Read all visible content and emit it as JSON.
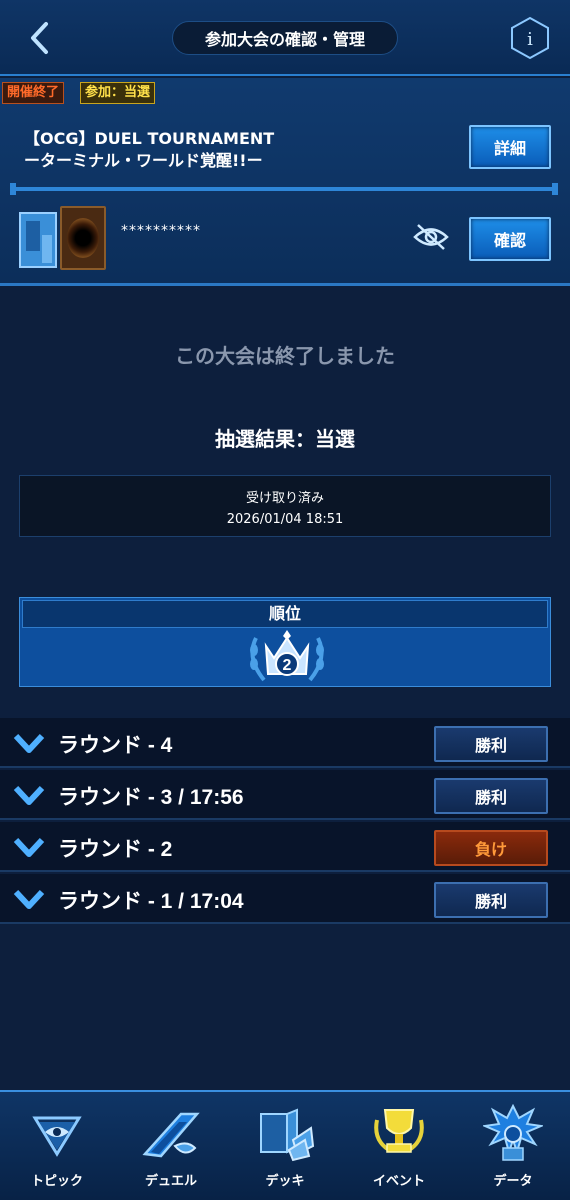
{
  "header": {
    "title": "参加大会の確認・管理",
    "info_label": "i"
  },
  "tournament": {
    "status_tag": "開催終了",
    "entry_tag": "参加：当選",
    "title_line1": "【OCG】DUEL TOURNAMENT",
    "title_line2": "ーターミナル・ワールド覚醒!!ー",
    "detail_button": "詳細",
    "deck_name_masked": "**********",
    "confirm_button": "確認"
  },
  "main": {
    "ended_message": "この大会は終了しました",
    "lottery_result": "抽選結果：当選",
    "receipt_status": "受け取り済み",
    "receipt_time": "2026/01/04 18:51",
    "rank_header": "順位",
    "rank_value": "2"
  },
  "rounds": [
    {
      "label": "ラウンド - 4",
      "result": "勝利",
      "outcome": "win"
    },
    {
      "label": "ラウンド - 3 / 17:56",
      "result": "勝利",
      "outcome": "win"
    },
    {
      "label": "ラウンド - 2",
      "result": "負け",
      "outcome": "lose"
    },
    {
      "label": "ラウンド - 1 / 17:04",
      "result": "勝利",
      "outcome": "win"
    }
  ],
  "nav": {
    "items": [
      {
        "label": "トピック",
        "icon": "millennium-eye-icon"
      },
      {
        "label": "デュエル",
        "icon": "duel-disk-icon"
      },
      {
        "label": "デッキ",
        "icon": "deck-icon"
      },
      {
        "label": "イベント",
        "icon": "trophy-icon"
      },
      {
        "label": "データ",
        "icon": "character-icon"
      }
    ]
  },
  "colors": {
    "accent": "#2e86d8",
    "win": "#1a3a6e",
    "lose": "#8a2a0c",
    "ended_tag": "#ff6a2a",
    "entry_tag": "#ffe04a"
  }
}
